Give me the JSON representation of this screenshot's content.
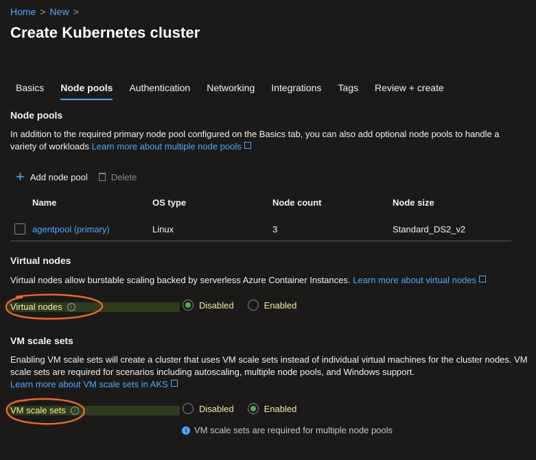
{
  "breadcrumb": {
    "home": "Home",
    "new": "New",
    "sep": ">"
  },
  "page": {
    "title": "Create Kubernetes cluster"
  },
  "tabs": [
    {
      "label": "Basics"
    },
    {
      "label": "Node pools"
    },
    {
      "label": "Authentication"
    },
    {
      "label": "Networking"
    },
    {
      "label": "Integrations"
    },
    {
      "label": "Tags"
    },
    {
      "label": "Review + create"
    }
  ],
  "node_pools": {
    "heading": "Node pools",
    "description": "In addition to the required primary node pool configured on the Basics tab, you can also add optional node pools to handle a variety of workloads",
    "learn_more": "Learn more about multiple node pools",
    "add_label": "Add node pool",
    "delete_label": "Delete",
    "columns": {
      "name": "Name",
      "os": "OS type",
      "count": "Node count",
      "size": "Node size"
    },
    "rows": [
      {
        "name": "agentpool (primary)",
        "os": "Linux",
        "count": "3",
        "size": "Standard_DS2_v2"
      }
    ]
  },
  "virtual_nodes": {
    "heading": "Virtual nodes",
    "description": "Virtual nodes allow burstable scaling backed by serverless Azure Container Instances.",
    "learn_more": "Learn more about virtual nodes",
    "field_label": "Virtual nodes",
    "options": {
      "disabled": "Disabled",
      "enabled": "Enabled"
    },
    "selected": "Disabled"
  },
  "vm_scale_sets": {
    "heading": "VM scale sets",
    "description": "Enabling VM scale sets will create a cluster that uses VM scale sets instead of individual virtual machines for the cluster nodes. VM scale sets are required for scenarios including autoscaling, multiple node pools, and Windows support.",
    "learn_more": "Learn more about VM scale sets in AKS",
    "field_label": "VM scale sets",
    "options": {
      "disabled": "Disabled",
      "enabled": "Enabled"
    },
    "selected": "Enabled",
    "info_message": "VM scale sets are required for multiple node pools"
  },
  "colors": {
    "accent": "#4ea9ff",
    "radio_selected": "#4caf50",
    "annotation": "#e8692a"
  }
}
